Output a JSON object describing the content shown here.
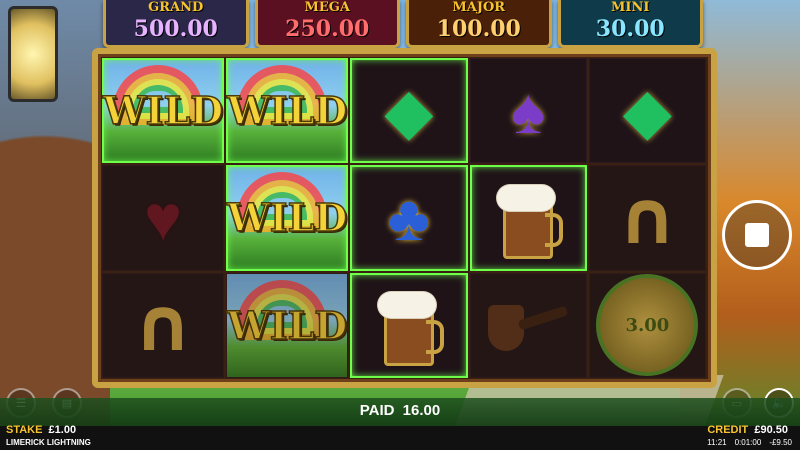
{
  "jackpots": [
    {
      "name": "GRAND",
      "amount": "500.00"
    },
    {
      "name": "MEGA",
      "amount": "250.00"
    },
    {
      "name": "MAJOR",
      "amount": "100.00"
    },
    {
      "name": "MINI",
      "amount": "30.00"
    }
  ],
  "reels": {
    "wild_label": "WILD",
    "coin_value": "3.00",
    "symbols": [
      [
        "wild",
        "wild",
        "diamond-green",
        "spade-purple",
        "diamond-green"
      ],
      [
        "heart-red",
        "wild",
        "club-blue",
        "beer-mug",
        "horseshoe"
      ],
      [
        "horseshoe",
        "wild",
        "beer-mug",
        "pipe",
        "coin"
      ]
    ]
  },
  "paid": {
    "label": "PAID",
    "value": "16.00"
  },
  "stake": {
    "label": "STAKE",
    "value": "£1.00"
  },
  "credit": {
    "label": "CREDIT",
    "value": "£90.50"
  },
  "footer": {
    "game_name": "LIMERICK LIGHTNING",
    "time": "11:21",
    "session": "0:01:00",
    "net": "-£9.50"
  },
  "icons": {
    "menu": "menu-icon",
    "info": "info-icon",
    "stop": "stop-icon",
    "sound": "sound-icon",
    "history": "history-icon"
  },
  "colors": {
    "frame_gold": "#c9a343",
    "win_highlight": "#6dff4a",
    "label_gold": "#f7c430"
  }
}
